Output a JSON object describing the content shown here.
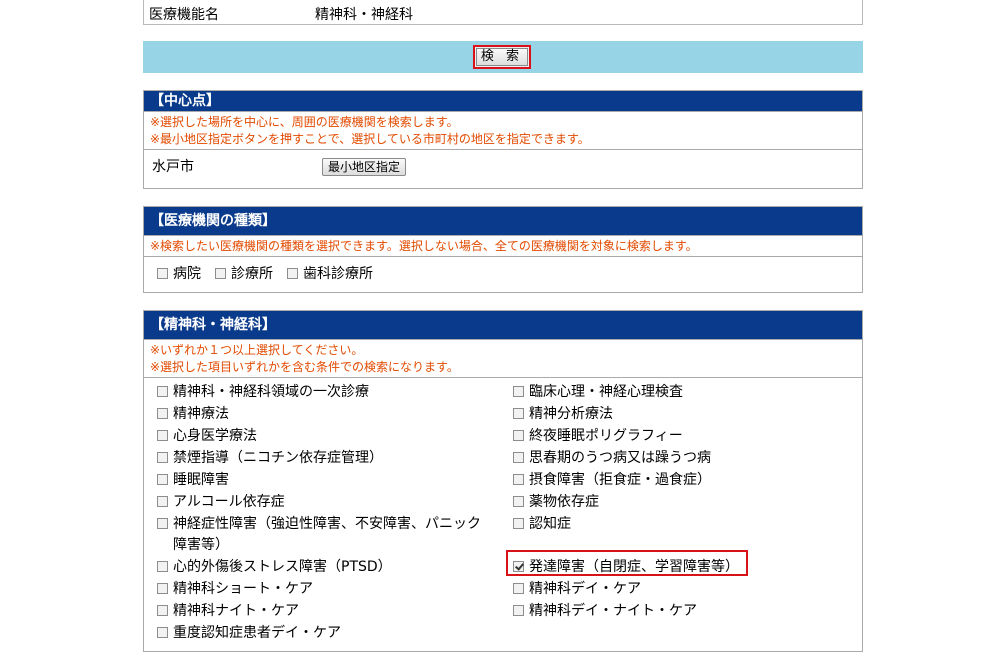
{
  "top_row": {
    "label": "医療機能名",
    "value": "精神科・神経科"
  },
  "search_button": "検 索",
  "center": {
    "title": "【中心点】",
    "notes": [
      "※選択した場所を中心に、周囲の医療機関を検索します。",
      "※最小地区指定ボタンを押すことで、選択している市町村の地区を指定できます。"
    ],
    "location": "水戸市",
    "min_area_button": "最小地区指定"
  },
  "facility_type": {
    "title": "【医療機関の種類】",
    "note": "※検索したい医療機関の種類を選択できます。選択しない場合、全ての医療機関を対象に検索します。",
    "options": [
      {
        "label": "病院",
        "checked": false
      },
      {
        "label": "診療所",
        "checked": false
      },
      {
        "label": "歯科診療所",
        "checked": false
      }
    ]
  },
  "psych": {
    "title": "【精神科・神経科】",
    "notes": [
      "※いずれか１つ以上選択してください。",
      "※選択した項目いずれかを含む条件での検索になります。"
    ],
    "left": [
      {
        "label": "精神科・神経科領域の一次診療",
        "checked": false
      },
      {
        "label": "精神療法",
        "checked": false
      },
      {
        "label": "心身医学療法",
        "checked": false
      },
      {
        "label": "禁煙指導（ニコチン依存症管理）",
        "checked": false
      },
      {
        "label": "睡眠障害",
        "checked": false
      },
      {
        "label": "アルコール依存症",
        "checked": false
      },
      {
        "label": "神経症性障害（強迫性障害、不安障害、パニック",
        "label2": "障害等）",
        "checked": false
      },
      {
        "label": "心的外傷後ストレス障害（PTSD）",
        "checked": false
      },
      {
        "label": "精神科ショート・ケア",
        "checked": false
      },
      {
        "label": "精神科ナイト・ケア",
        "checked": false
      },
      {
        "label": "重度認知症患者デイ・ケア",
        "checked": false
      }
    ],
    "right": [
      {
        "label": "臨床心理・神経心理検査",
        "checked": false
      },
      {
        "label": "精神分析療法",
        "checked": false
      },
      {
        "label": "終夜睡眠ポリグラフィー",
        "checked": false
      },
      {
        "label": "思春期のうつ病又は躁うつ病",
        "checked": false
      },
      {
        "label": "摂食障害（拒食症・過食症）",
        "checked": false
      },
      {
        "label": "薬物依存症",
        "checked": false
      },
      {
        "label": "認知症",
        "checked": false
      },
      {
        "label": "発達障害（自閉症、学習障害等）",
        "checked": true
      },
      {
        "label": "精神科デイ・ケア",
        "checked": false
      },
      {
        "label": "精神科デイ・ナイト・ケア",
        "checked": false
      }
    ]
  }
}
